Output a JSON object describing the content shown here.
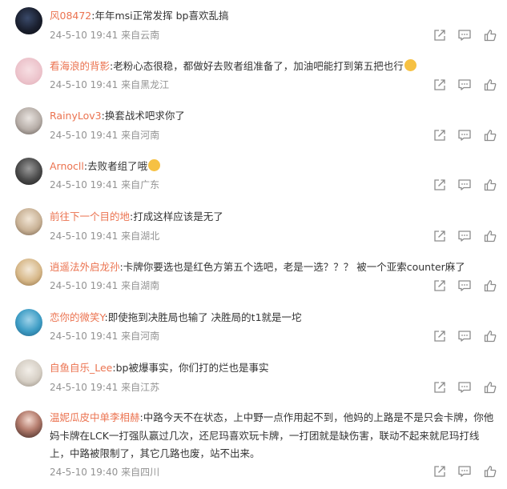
{
  "colors": {
    "author": "#eb7350",
    "text": "#333333",
    "meta": "#939393",
    "icon": "#8c8c8c"
  },
  "icons": {
    "share": "share-icon",
    "reply": "comment-icon",
    "like": "thumbs-up-icon"
  },
  "comments": [
    {
      "author": "风08472",
      "content": "年年msi正常发挥 bp喜欢乱搞",
      "time": "24-5-10 19:41",
      "location": "来自云南"
    },
    {
      "author": "看海浪的背影",
      "content": "老粉心态很稳，都做好去败者组准备了，加油吧能打到第五把也行",
      "time": "24-5-10 19:41",
      "location": "来自黑龙江"
    },
    {
      "author": "RainyLov3",
      "content": "换套战术吧求你了",
      "time": "24-5-10 19:41",
      "location": "来自河南"
    },
    {
      "author": "Arnocll",
      "content": "去败者组了哦",
      "time": "24-5-10 19:41",
      "location": "来自广东"
    },
    {
      "author": "前往下一个目的地",
      "content": "打成这样应该是无了",
      "time": "24-5-10 19:41",
      "location": "来自湖北"
    },
    {
      "author": "逍遥法外启龙孙",
      "content": "卡牌你要选也是红色方第五个选吧，老是一选？？？ 被一个亚索counter麻了",
      "time": "24-5-10 19:41",
      "location": "来自湖南"
    },
    {
      "author": "恋你的微笑Y",
      "content": "即使拖到决胜局也输了 决胜局的t1就是一坨",
      "time": "24-5-10 19:41",
      "location": "来自河南"
    },
    {
      "author": "自鱼自乐_Lee",
      "content": "bp被爆事实，你们打的烂也是事实",
      "time": "24-5-10 19:41",
      "location": "来自江苏"
    },
    {
      "author": "温妮瓜皮中单李相赫",
      "content": "中路今天不在状态，上中野一点作用起不到，他妈的上路是不是只会卡牌，你他妈卡牌在LCK一打强队赢过几次，还尼玛喜欢玩卡牌，一打团就是缺伤害，联动不起来就尼玛打线上，中路被限制了，其它几路也废，站不出来。",
      "time": "24-5-10 19:40",
      "location": "来自四川"
    }
  ]
}
